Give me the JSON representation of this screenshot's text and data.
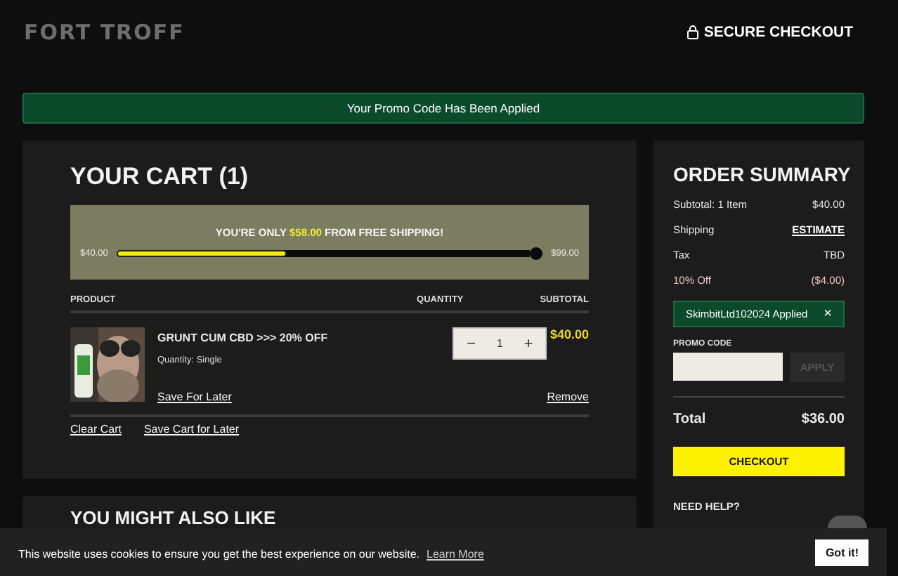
{
  "header": {
    "logo": "FORT TROFF",
    "secure_checkout": "SECURE CHECKOUT"
  },
  "banner": "Your Promo Code Has Been Applied",
  "cart": {
    "title": "YOUR CART (1)",
    "shipping": {
      "message": "YOU'RE ONLY **$58.00** FROM FREE SHIPPING!",
      "min": "$40.00",
      "max": "$99.00",
      "level": 0.41
    },
    "columns": [
      "PRODUCT",
      "QUANTITY",
      "SUBTOTAL"
    ],
    "items": [
      {
        "name": "GRUNT CUM CBD >>> 20% OFF",
        "option": "Quantity: Single",
        "quantity": "1",
        "minus": "−",
        "plus": "+",
        "subtotal": "$40.00",
        "save": "Save For Later",
        "remove": "Remove"
      }
    ],
    "links": [
      "Clear Cart",
      "Save Cart for Later"
    ]
  },
  "also_like": "YOU MIGHT ALSO LIKE",
  "summary": {
    "title": "ORDER SUMMARY",
    "rows": [
      {
        "kind": "plain",
        "label": "Subtotal: 1 Item",
        "value": "$40.00"
      },
      {
        "kind": "link",
        "label": "Shipping",
        "value": "ESTIMATE"
      },
      {
        "kind": "plain",
        "label": "Tax",
        "value": "TBD"
      },
      {
        "kind": "discount",
        "label": "10% Off",
        "value": "($4.00)"
      }
    ],
    "applied": {
      "text": "SkimbitLtd102024 Applied",
      "close": "×"
    },
    "promo_label": "PROMO CODE",
    "apply": "APPLY",
    "apply_disabled": true,
    "total_label": "Total",
    "total": "$36.00",
    "checkout": "CHECKOUT",
    "help": "NEED HELP?"
  },
  "cookie": {
    "text": "This website uses cookies to ensure you get the best experience on our website.",
    "link": "Learn More",
    "button": "Got it!"
  }
}
